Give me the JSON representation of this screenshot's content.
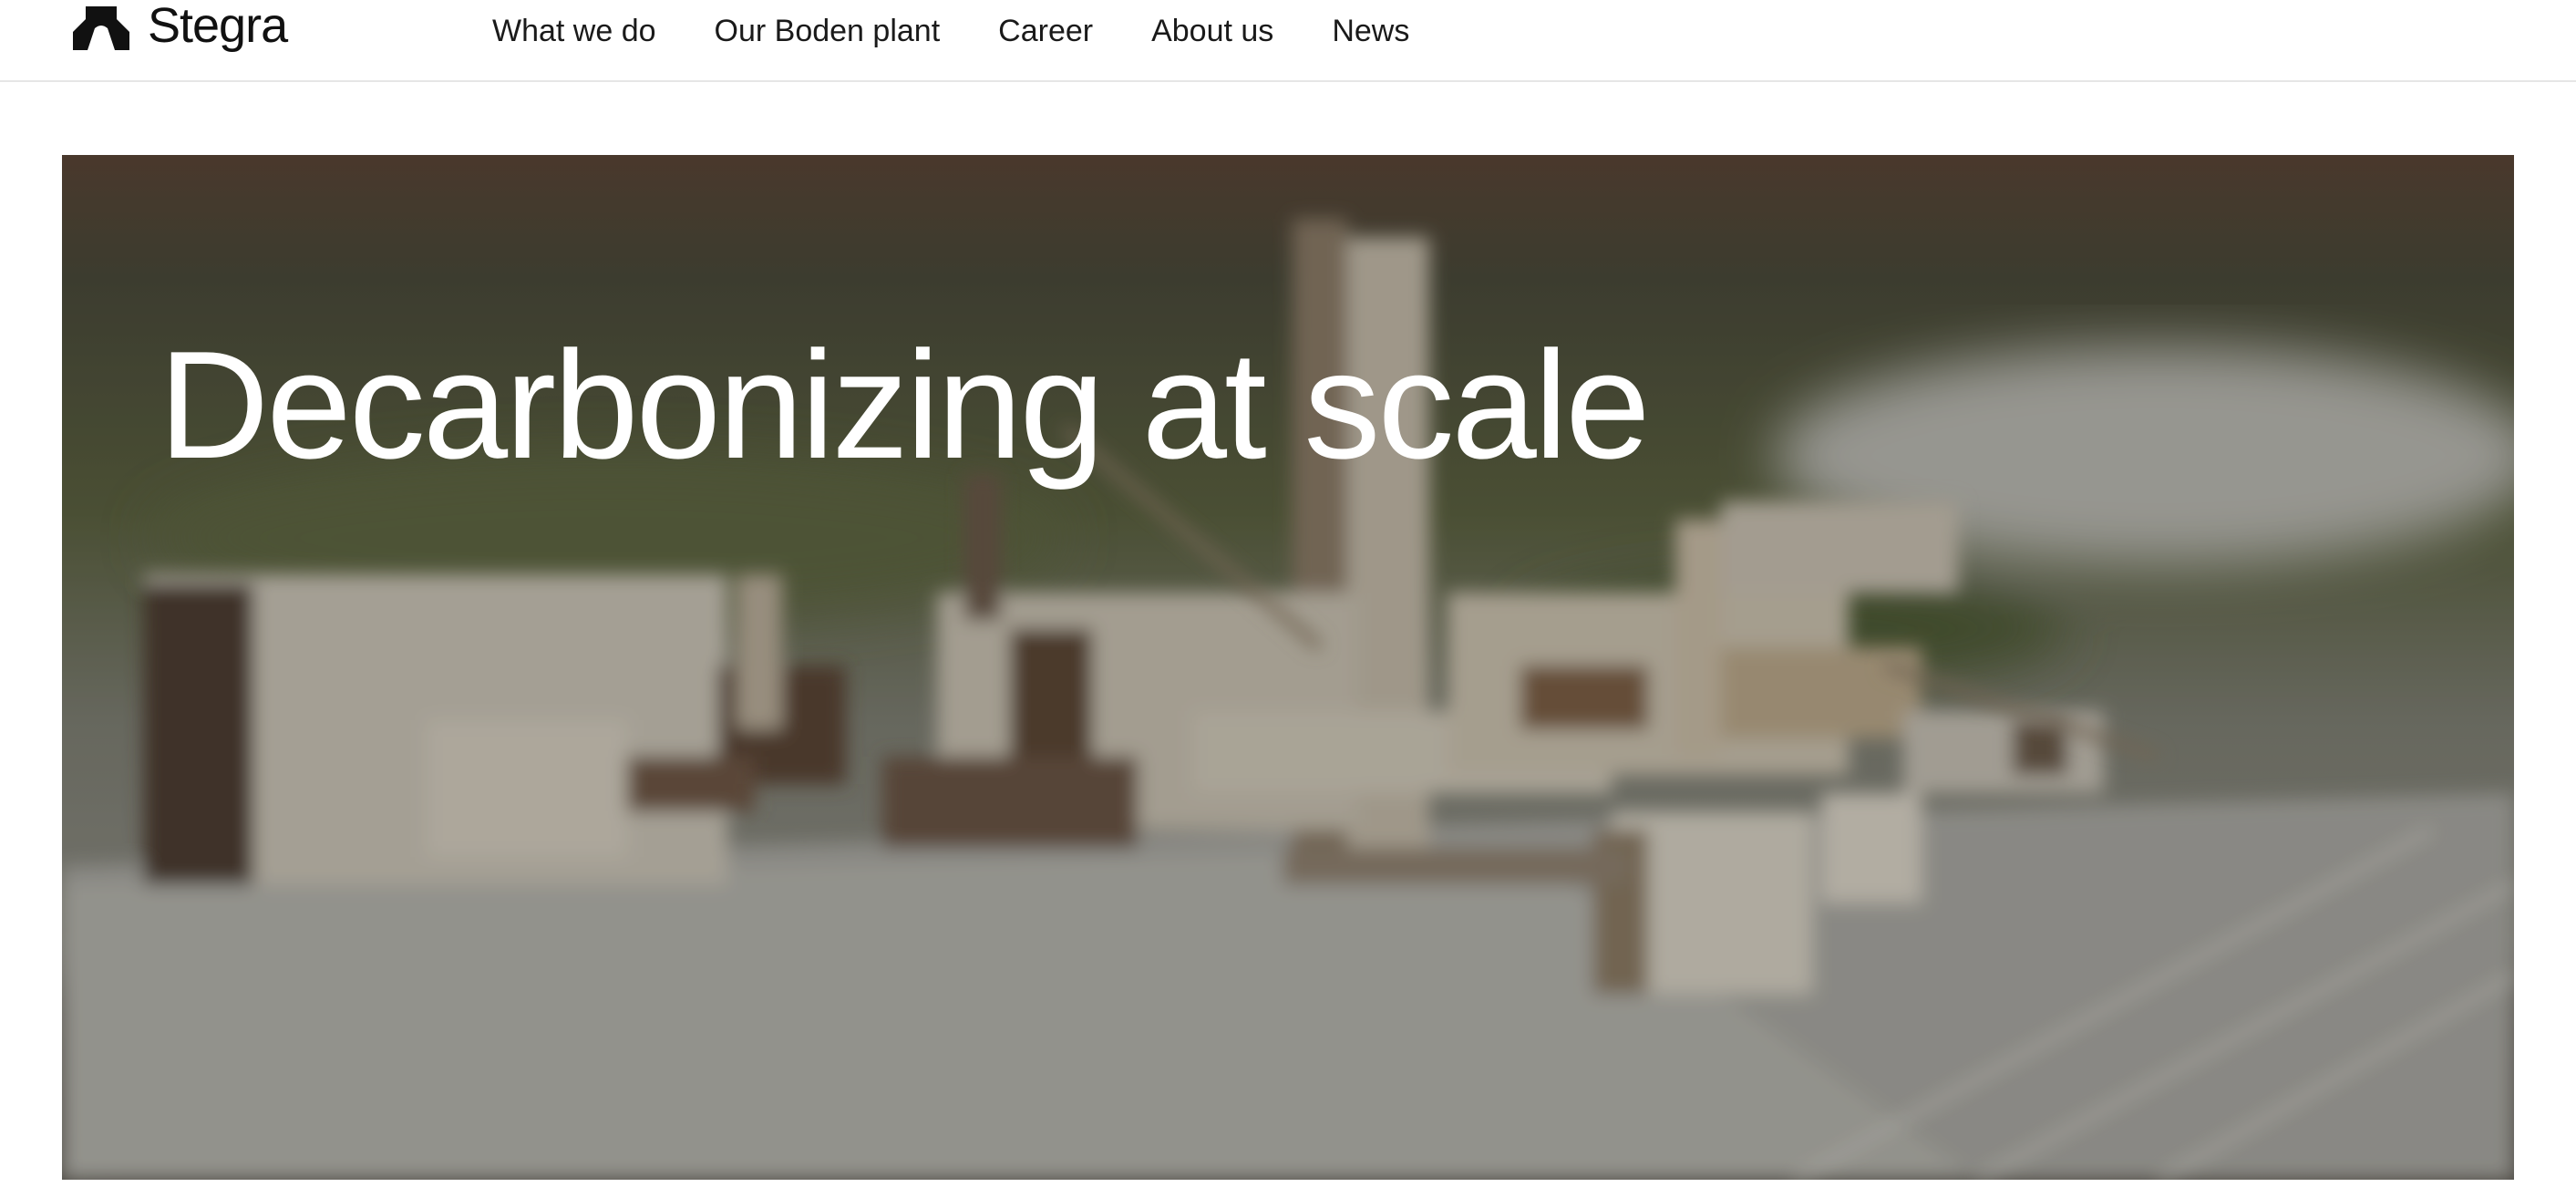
{
  "header": {
    "logo": {
      "text": "Stegra",
      "icon": "stegra-logo-icon"
    },
    "nav": [
      {
        "label": "What we do"
      },
      {
        "label": "Our Boden plant"
      },
      {
        "label": "Career"
      },
      {
        "label": "About us"
      },
      {
        "label": "News"
      }
    ]
  },
  "hero": {
    "title": "Decarbonizing at scale"
  },
  "colors": {
    "text": "#111111",
    "hero_text": "#ffffff",
    "divider": "#e6e6e6"
  }
}
